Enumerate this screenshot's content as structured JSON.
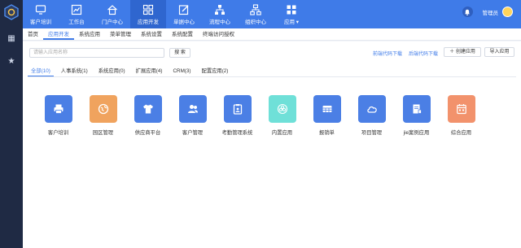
{
  "topnav": [
    {
      "label": "客户培训",
      "icon": "monitor-icon"
    },
    {
      "label": "工作台",
      "icon": "chart-icon"
    },
    {
      "label": "门户中心",
      "icon": "home-icon"
    },
    {
      "label": "应用开发",
      "icon": "grid-icon",
      "active": true
    },
    {
      "label": "单据中心",
      "icon": "edit-icon"
    },
    {
      "label": "流程中心",
      "icon": "flow-icon"
    },
    {
      "label": "组织中心",
      "icon": "org-icon"
    },
    {
      "label": "应用 ▾",
      "icon": "apps-icon"
    }
  ],
  "user": {
    "name": "管理员"
  },
  "subtabs": [
    "首页",
    "应用开发",
    "系统应用",
    "菜单管理",
    "系统设置",
    "系统配置",
    "终端访问授权"
  ],
  "search": {
    "placeholder": "请输入应用名称"
  },
  "buttons": {
    "search": "搜 索",
    "frontend_download": "前端代码下载",
    "backend_download": "后端代码下载",
    "create": "＋ 创建应用",
    "import": "导入应用"
  },
  "filters": [
    "全部(10)",
    "人事系统(1)",
    "系统应用(0)",
    "扩展应用(4)",
    "CRM(3)",
    "配置应用(2)"
  ],
  "apps": [
    {
      "label": "客户培训",
      "color": "#4b7fe5"
    },
    {
      "label": "园区管理",
      "color": "#f0a35e"
    },
    {
      "label": "供应商平台",
      "color": "#4b7fe5"
    },
    {
      "label": "客户管理",
      "color": "#4b7fe5"
    },
    {
      "label": "考勤管理系统",
      "color": "#4b7fe5"
    },
    {
      "label": "内置应用",
      "color": "#6fe0d8"
    },
    {
      "label": "报销单",
      "color": "#4b7fe5"
    },
    {
      "label": "项目管理",
      "color": "#4b7fe5"
    },
    {
      "label": "jie案例应用",
      "color": "#4b7fe5"
    },
    {
      "label": "综合应用",
      "color": "#f2926c"
    }
  ],
  "colors": {
    "primary": "#3f7be8",
    "rail": "#1f2a44"
  }
}
